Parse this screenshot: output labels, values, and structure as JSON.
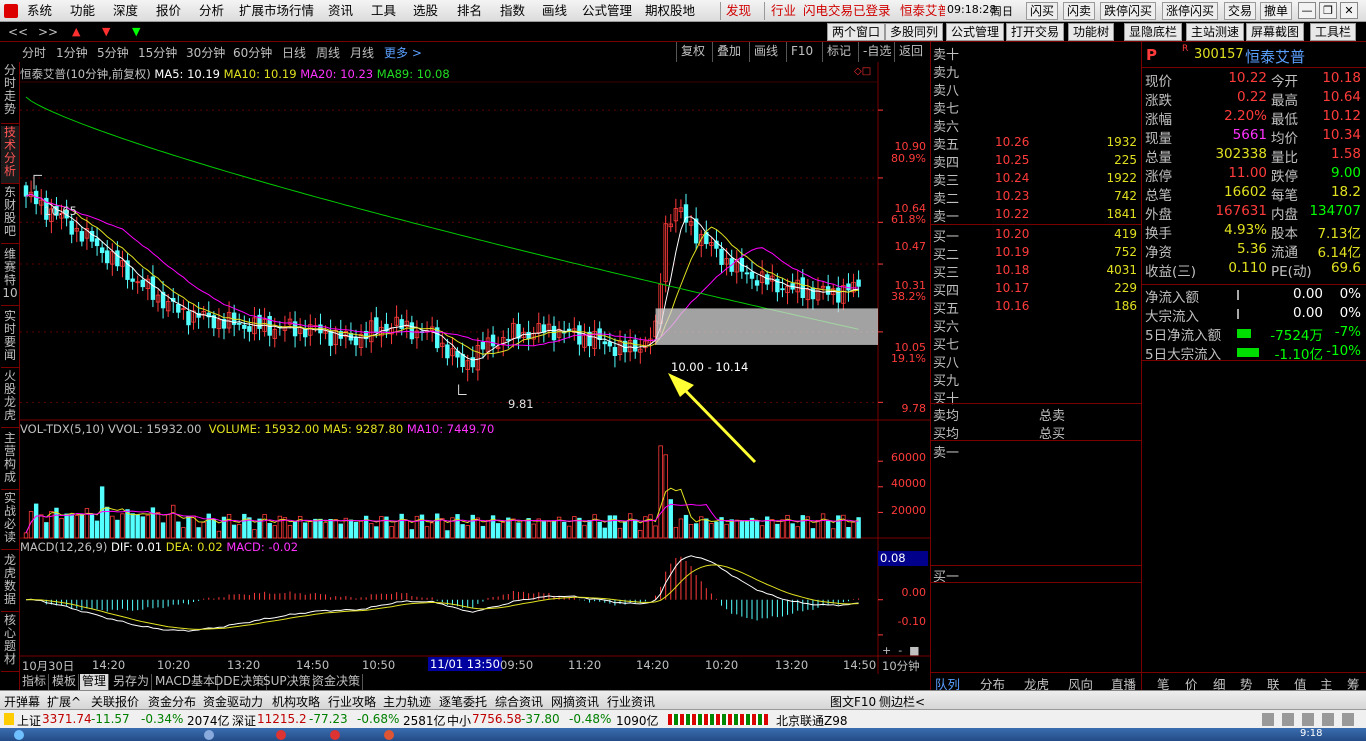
{
  "menu": {
    "items": [
      "系统",
      "功能",
      "深度",
      "报价",
      "分析",
      "扩展市场行情",
      "资讯",
      "工具",
      "选股",
      "排名",
      "指数",
      "画线",
      "公式管理",
      "期权股地"
    ],
    "warn": "发现",
    "industry": "行业",
    "flash_login": "闪电交易已登录",
    "stock_name": "恒泰艾普",
    "time": "09:18:28",
    "weekday": "周日",
    "trade_buttons": [
      "闪买",
      "闪卖",
      "跌停闪买",
      "涨停闪买",
      "交易",
      "撤单"
    ]
  },
  "toolbar2": {
    "nav": [
      "<<",
      ">>"
    ],
    "buttons": [
      "两个窗口",
      "多股同列",
      "公式管理",
      "打开交易",
      "功能树",
      "显隐底栏",
      "主站测速",
      "屏幕截图",
      "工具栏"
    ]
  },
  "periods": {
    "items": [
      "分时",
      "1分钟",
      "5分钟",
      "15分钟",
      "30分钟",
      "60分钟",
      "日线",
      "周线",
      "月线"
    ],
    "more": "更多 >",
    "right": [
      "复权",
      "叠加",
      "画线",
      "F10",
      "标记",
      "-自选",
      "返回"
    ]
  },
  "left_tabs": [
    "分时走势",
    "技术分析",
    "东财股吧",
    "维赛特10",
    "实时要闻",
    "火股龙虎",
    "主营构成",
    "实战必读",
    "龙虎数据",
    "核心题材"
  ],
  "chart_data": [
    {
      "type": "candlestick",
      "title": "恒泰艾普(10分钟,前复权)",
      "indicators": [
        {
          "name": "MA5",
          "value": "10.19",
          "color": "#ffffff"
        },
        {
          "name": "MA10",
          "value": "10.19",
          "color": "#e0e020"
        },
        {
          "name": "MA20",
          "value": "10.23",
          "color": "#ff00ff"
        },
        {
          "name": "MA89",
          "value": "10.08",
          "color": "#00cc00"
        }
      ],
      "y_ticks": [
        {
          "value": "10.90",
          "pct": "80.9%"
        },
        {
          "value": "10.64",
          "pct": "61.8%"
        },
        {
          "value": "10.47",
          "pct": ""
        },
        {
          "value": "10.31",
          "pct": "38.2%"
        },
        {
          "value": "10.05",
          "pct": "19.1%"
        },
        {
          "value": "9.78",
          "pct": ""
        }
      ],
      "ylim": [
        9.72,
        11.0
      ],
      "annotations": {
        "high": "10.65",
        "low": "9.81",
        "range": "10.00 - 10.14"
      },
      "box": {
        "low": 10.0,
        "high": 10.14
      },
      "ma89_start": 10.95,
      "ma89_end": 10.06
    },
    {
      "type": "bar",
      "title": "VOL-TDX(5,10)",
      "values_text": {
        "vvol": "VVOL: 15932.00",
        "volume": "VOLUME: 15932.00",
        "ma5": "MA5: 9287.80",
        "ma10": "MA10: 7449.70"
      },
      "y_ticks": [
        "60000",
        "40000",
        "20000"
      ],
      "ylim": [
        0,
        75000
      ]
    },
    {
      "type": "line",
      "title": "MACD(12,26,9)",
      "values_text": {
        "dif": "DIF: 0.01",
        "dea": "DEA: 0.02",
        "macd": "MACD: -0.02"
      },
      "y_ticks": [
        "0.00",
        "-0.10"
      ],
      "cursor_value": "0.08",
      "ylim": [
        -0.16,
        0.13
      ]
    }
  ],
  "x_axis": {
    "labels": [
      "10月30日",
      "14:20",
      "10:20",
      "13:20",
      "14:50",
      "10:50",
      "11/01 13:50",
      "09:50",
      "11:20",
      "14:20",
      "10:20",
      "13:20",
      "14:50"
    ],
    "period": "10分钟"
  },
  "bottom_tabs": [
    "指标",
    "模板",
    "管理",
    "另存为",
    "MACD基本",
    "DDE决策",
    "SUP决策",
    "资金决策"
  ],
  "orderbook": {
    "sell_labels": [
      "卖十",
      "卖九",
      "卖八",
      "卖七",
      "卖六",
      "卖五",
      "卖四",
      "卖三",
      "卖二",
      "卖一"
    ],
    "buy_labels": [
      "买一",
      "买二",
      "买三",
      "买四",
      "买五",
      "买六",
      "买七",
      "买八",
      "买九",
      "买十"
    ],
    "sells": [
      {
        "price": "10.26",
        "vol": "1932"
      },
      {
        "price": "10.25",
        "vol": "225"
      },
      {
        "price": "10.24",
        "vol": "1922"
      },
      {
        "price": "10.23",
        "vol": "742"
      },
      {
        "price": "10.22",
        "vol": "1841"
      }
    ],
    "buys": [
      {
        "price": "10.20",
        "vol": "419"
      },
      {
        "price": "10.19",
        "vol": "752"
      },
      {
        "price": "10.18",
        "vol": "4031"
      },
      {
        "price": "10.17",
        "vol": "229"
      },
      {
        "price": "10.16",
        "vol": "186"
      }
    ],
    "avg_sell": "卖均",
    "avg_buy": "买均",
    "total_sell": "总卖",
    "total_buy": "总买",
    "sell_one": "卖一",
    "buy_one": "买一"
  },
  "quote": {
    "code": "300157",
    "name": "恒泰艾普",
    "rows": [
      {
        "k1": "现价",
        "v1": "10.22",
        "c1": "#ff3b3b",
        "k2": "今开",
        "v2": "10.18",
        "c2": "#ff3b3b"
      },
      {
        "k1": "涨跌",
        "v1": "0.22",
        "c1": "#ff3b3b",
        "k2": "最高",
        "v2": "10.64",
        "c2": "#ff3b3b"
      },
      {
        "k1": "涨幅",
        "v1": "2.20%",
        "c1": "#ff3b3b",
        "k2": "最低",
        "v2": "10.12",
        "c2": "#ff3b3b"
      },
      {
        "k1": "现量",
        "v1": "5661",
        "c1": "#ff33ff",
        "k2": "均价",
        "v2": "10.34",
        "c2": "#ff3b3b"
      },
      {
        "k1": "总量",
        "v1": "302338",
        "c1": "#e0e020",
        "k2": "量比",
        "v2": "1.58",
        "c2": "#ff3b3b"
      },
      {
        "k1": "涨停",
        "v1": "11.00",
        "c1": "#ff3b3b",
        "k2": "跌停",
        "v2": "9.00",
        "c2": "#00ff00"
      },
      {
        "k1": "总笔",
        "v1": "16602",
        "c1": "#e0e020",
        "k2": "每笔",
        "v2": "18.2",
        "c2": "#e0e020"
      },
      {
        "k1": "外盘",
        "v1": "167631",
        "c1": "#ff3b3b",
        "k2": "内盘",
        "v2": "134707",
        "c2": "#00ff00"
      },
      {
        "k1": "换手",
        "v1": "4.93%",
        "c1": "#e0e020",
        "k2": "股本",
        "v2": "7.13亿",
        "c2": "#e0e020"
      },
      {
        "k1": "净资",
        "v1": "5.36",
        "c1": "#e0e020",
        "k2": "流通",
        "v2": "6.14亿",
        "c2": "#e0e020"
      },
      {
        "k1": "收益(三)",
        "v1": "0.110",
        "c1": "#e0e020",
        "k2": "PE(动)",
        "v2": "69.6",
        "c2": "#e0e020"
      }
    ],
    "flows": [
      {
        "k": "净流入额",
        "v": "0.00",
        "p": "0%",
        "c": "#ffffff"
      },
      {
        "k": "大宗流入",
        "v": "0.00",
        "p": "0%",
        "c": "#ffffff"
      },
      {
        "k": "5日净流入额",
        "v": "-7524万",
        "p": "-7%",
        "c": "#00ff00"
      },
      {
        "k": "5日大宗流入",
        "v": "-1.10亿",
        "p": "-10%",
        "c": "#00ff00"
      }
    ],
    "tabs": [
      "队列",
      "分布",
      "龙虎",
      "风向",
      "直播",
      "笔",
      "价",
      "细",
      "势",
      "联",
      "值",
      "主",
      "筹"
    ]
  },
  "funcbar": {
    "items": [
      "开弹幕",
      "扩展^",
      "关联报价",
      "资金分布",
      "资金驱动力",
      "机构攻略",
      "行业攻略",
      "主力轨迹",
      "逐笔委托",
      "综合资讯",
      "网摘资讯",
      "行业资讯"
    ],
    "right": [
      "图文F10",
      "侧边栏<"
    ]
  },
  "status": {
    "sh_label": "上证",
    "sh_val": "3371.74",
    "sh_chg": "-11.57",
    "sh_pct": "-0.34%",
    "sh_amt": "2074亿",
    "sz_label": "深证",
    "sz_val": "11215.2",
    "sz_chg": "-77.23",
    "sz_pct": "-0.68%",
    "sz_amt": "2581亿",
    "sme_label": "中小",
    "sme_val": "7756.58",
    "sme_chg": "-37.80",
    "sme_pct": "-0.48%",
    "sme_amt": "1090亿",
    "server": "北京联通Z98"
  },
  "taskbar": {
    "time": "9:18"
  },
  "colors": {
    "up": "#ff3b3b",
    "down": "#54ffff",
    "ma5": "#ffffff",
    "ma10": "#e0e020",
    "ma20": "#ff00ff",
    "ma89": "#00cc00",
    "frame": "#7a0000"
  }
}
